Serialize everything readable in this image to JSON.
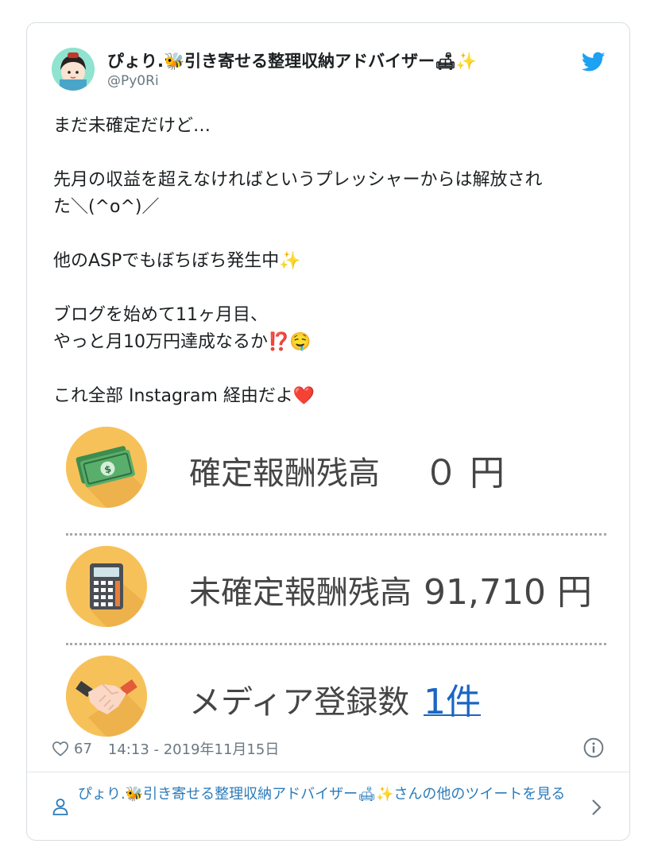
{
  "tweet": {
    "display_name": "ぴょり.🐝引き寄せる整理収納アドバイザー🛋✨",
    "handle": "@Py0Ri",
    "paragraphs": [
      [
        "まだ未確定だけど…"
      ],
      [
        "先月の収益を超えなければというプレッシャーからは解放され",
        "た＼(^o^)／"
      ],
      [
        "他のASPでもぼちぼち発生中✨"
      ],
      [
        "ブログを始めて11ヶ月目、",
        "やっと月10万円達成なるか⁉️🤤"
      ],
      [
        "これ全部 Instagram 経由だよ❤️"
      ]
    ],
    "like_count": "67",
    "timestamp": "14:13 - 2019年11月15日"
  },
  "media": {
    "rows": [
      {
        "label": "確定報酬残高",
        "value": "０ 円",
        "icon": "money-bills-icon"
      },
      {
        "label": "未確定報酬残高",
        "value": "91,710 円",
        "icon": "calculator-icon"
      },
      {
        "label": "メディア登録数",
        "value": "1件",
        "icon": "handshake-icon"
      }
    ]
  },
  "footer": {
    "more_tweets": "ぴょり.🐝引き寄せる整理収納アドバイザー🛋✨さんの他のツイートを見る"
  },
  "colors": {
    "link": "#2b7bb9",
    "twitter_blue": "#1da1f2",
    "icon_circle": "#f7c15a",
    "heart": "#e0245e"
  }
}
